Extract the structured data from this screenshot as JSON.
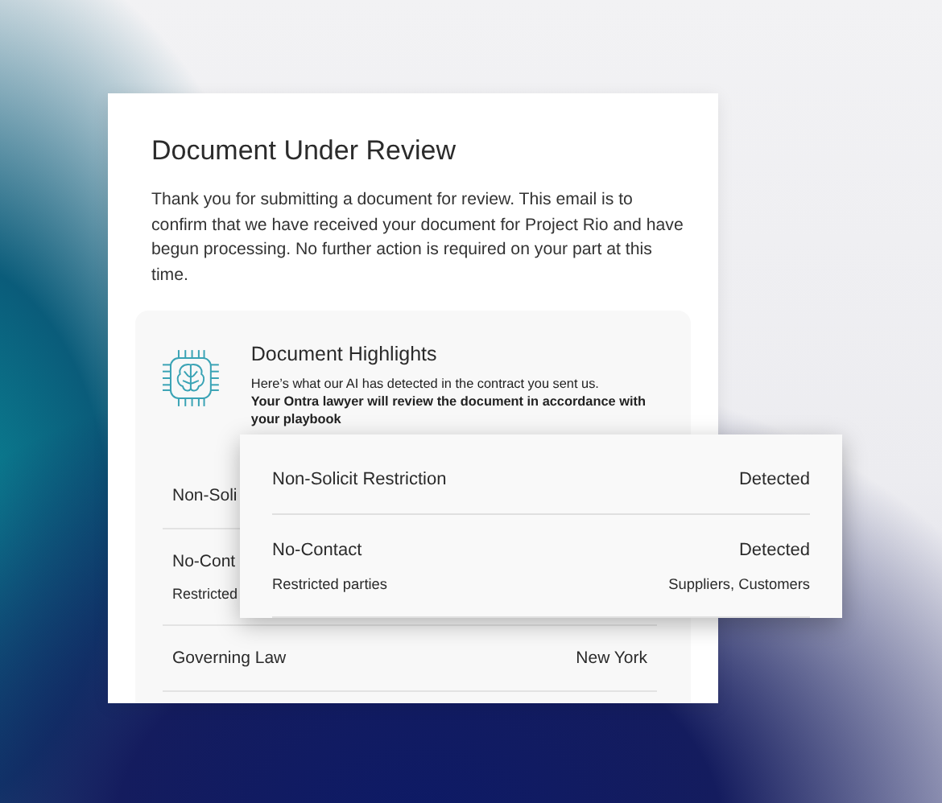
{
  "email": {
    "title": "Document Under Review",
    "body": "Thank you for submitting a document for review. This email is to confirm that we have received your document for Project Rio and have begun processing. No further action is required on your part at this time.",
    "highlights": {
      "title": "Document Highlights",
      "intro": "Here’s what our AI has detected in the contract you sent us.",
      "note": "Your Ontra lawyer will review the document in accordance with your playbook",
      "rows": [
        {
          "label": "Non-Soli"
        },
        {
          "label": "No-Cont",
          "sub_label": "Restricted"
        },
        {
          "label": "Governing Law",
          "value": "New York"
        }
      ]
    }
  },
  "popout": {
    "rows": [
      {
        "label": "Non-Solicit Restriction",
        "value": "Detected"
      },
      {
        "label": "No-Contact",
        "value": "Detected",
        "sub_label": "Restricted parties",
        "sub_value": "Suppliers, Customers"
      }
    ]
  }
}
